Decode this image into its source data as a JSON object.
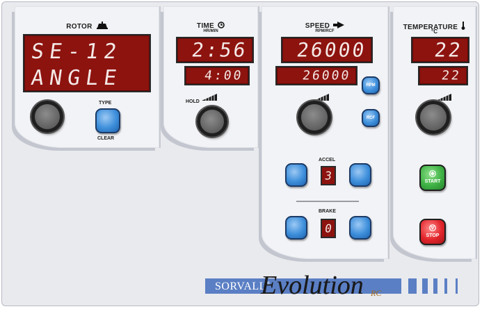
{
  "rotor": {
    "title": "ROTOR",
    "line1": "SE-12",
    "line2": "ANGLE",
    "type_label": "TYPE",
    "clear_label": "CLEAR"
  },
  "time": {
    "title": "TIME",
    "subtitle": "HR/MIN",
    "actual": "2:56",
    "set": "4:00",
    "hold_label": "HOLD"
  },
  "speed": {
    "title": "SPEED",
    "subtitle": "RPM/RCF",
    "actual": "26000",
    "set": "26000",
    "rpm_label": "RPM",
    "rcf_label": "RCF",
    "accel_label": "ACCEL",
    "accel_value": "3",
    "brake_label": "BRAKE",
    "brake_value": "0"
  },
  "temperature": {
    "title": "TEMPERATURE",
    "subtitle": "°C",
    "actual": "22",
    "set": "22"
  },
  "controls": {
    "start_label": "START",
    "stop_label": "STOP"
  },
  "brand": {
    "name": "SORVALL",
    "mark": "®",
    "model": "Evolution",
    "suffix": "RC"
  },
  "colors": {
    "display_bg": "#8d130f",
    "display_text": "#f4e9e6",
    "panel_bg": "#e9eaee",
    "button_blue": "#3e8fdb",
    "start_green": "#3fb245",
    "stop_red": "#e2252b",
    "brand_blue": "#5b7fc4"
  },
  "icons": {
    "rotor": "rotor-icon",
    "time": "clock-icon",
    "speed": "speed-arrow-icon",
    "temperature": "thermometer-icon",
    "knob_adjust": "ramp-signal-icon"
  }
}
